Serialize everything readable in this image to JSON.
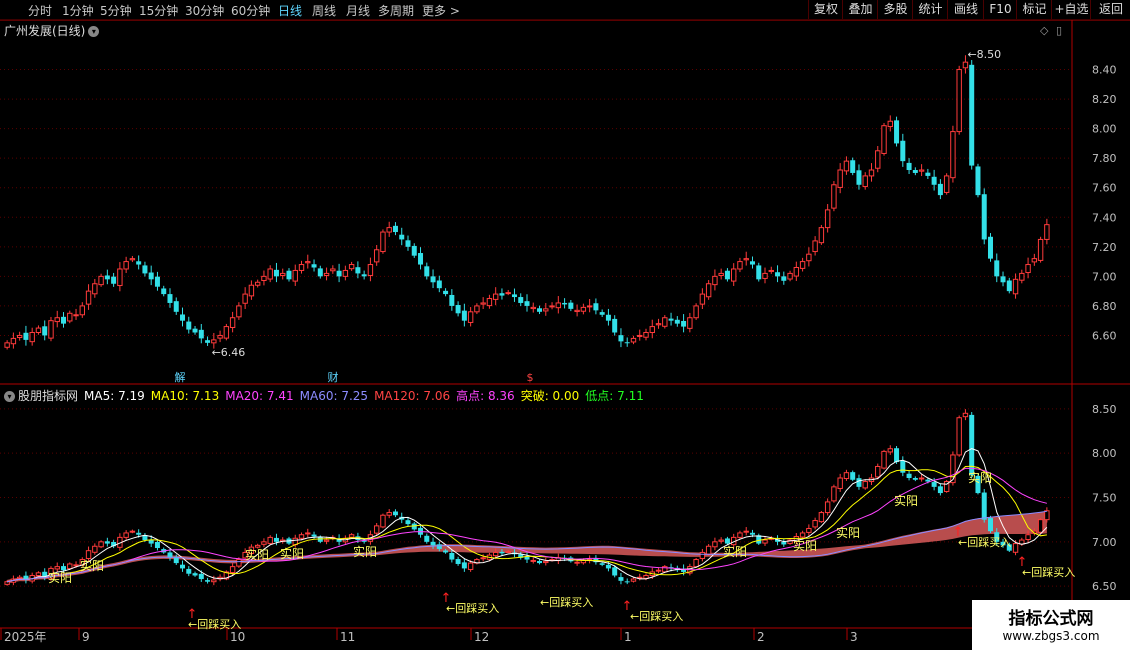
{
  "toolbar": {
    "timeframes": [
      "分时",
      "1分钟",
      "5分钟",
      "15分钟",
      "30分钟",
      "60分钟",
      "日线",
      "周线",
      "月线",
      "多周期",
      "更多"
    ],
    "active_timeframe": "日线",
    "right_buttons": [
      "复权",
      "叠加",
      "多股",
      "统计",
      "画线",
      "F10",
      "标记",
      "+自选",
      "返回"
    ]
  },
  "main_panel": {
    "title": "广州发展(日线)",
    "y_ticks": [
      "8.40",
      "8.20",
      "8.00",
      "7.80",
      "7.60",
      "7.40",
      "7.20",
      "7.00",
      "6.80",
      "6.60"
    ],
    "high_marker": "8.50",
    "low_marker": "6.46",
    "event_labels": [
      "解",
      "财",
      "$"
    ]
  },
  "indicator_panel": {
    "name": "股朋指标网",
    "values": [
      {
        "label": "MA5: 7.19",
        "color": "#ffffff"
      },
      {
        "label": "MA10: 7.13",
        "color": "#ffff00"
      },
      {
        "label": "MA20: 7.41",
        "color": "#ff44ff"
      },
      {
        "label": "MA60: 7.25",
        "color": "#8c8cff"
      },
      {
        "label": "MA120: 7.06",
        "color": "#ff4444"
      },
      {
        "label": "高点: 8.36",
        "color": "#ff44ff"
      },
      {
        "label": "突破: 0.00",
        "color": "#ffff00"
      },
      {
        "label": "低点: 7.11",
        "color": "#22ff22"
      }
    ],
    "y_ticks": [
      "8.50",
      "8.00",
      "7.50",
      "7.00",
      "6.50"
    ],
    "signal_labels": [
      "实阳",
      "实阳",
      "实阳",
      "实阳",
      "实阳",
      "实阳",
      "实阳",
      "实阳",
      "实阳",
      "实阳"
    ],
    "callback_labels": [
      "←回踩买入",
      "←回踩买入",
      "←回踩买入",
      "←回踩买入",
      "←回踩买入",
      "←回踩买入"
    ]
  },
  "x_axis": {
    "labels": [
      "2025年",
      "9",
      "10",
      "11",
      "12",
      "1",
      "2",
      "3"
    ]
  },
  "watermark": {
    "title": "指标公式网",
    "url": "www.zbgs3.com"
  },
  "chart_data": {
    "type": "candlestick",
    "security": "广州发展",
    "period": "日线",
    "ylim_main": [
      6.4,
      8.6
    ],
    "ylim_indicator": [
      6.4,
      8.6
    ],
    "x_ticks": [
      "2025年",
      "9",
      "10",
      "11",
      "12",
      "1",
      "2",
      "3"
    ],
    "closes": [
      6.55,
      6.58,
      6.6,
      6.57,
      6.62,
      6.65,
      6.6,
      6.7,
      6.72,
      6.68,
      6.75,
      6.74,
      6.8,
      6.9,
      6.95,
      7.0,
      6.98,
      6.95,
      7.05,
      7.1,
      7.12,
      7.08,
      7.02,
      6.98,
      6.93,
      6.88,
      6.82,
      6.76,
      6.7,
      6.64,
      6.62,
      6.58,
      6.55,
      6.57,
      6.6,
      6.66,
      6.72,
      6.8,
      6.88,
      6.94,
      6.96,
      7.0,
      7.05,
      7.0,
      7.02,
      6.98,
      7.04,
      7.08,
      7.1,
      7.06,
      7.0,
      7.02,
      7.05,
      7.0,
      7.04,
      7.08,
      7.02,
      7.0,
      7.08,
      7.18,
      7.3,
      7.33,
      7.3,
      7.25,
      7.2,
      7.14,
      7.08,
      7.0,
      6.96,
      6.92,
      6.88,
      6.8,
      6.75,
      6.7,
      6.76,
      6.8,
      6.82,
      6.85,
      6.88,
      6.87,
      6.89,
      6.86,
      6.82,
      6.8,
      6.79,
      6.76,
      6.78,
      6.8,
      6.82,
      6.81,
      6.78,
      6.77,
      6.79,
      6.8,
      6.77,
      6.74,
      6.7,
      6.62,
      6.56,
      6.55,
      6.58,
      6.6,
      6.62,
      6.66,
      6.68,
      6.72,
      6.7,
      6.68,
      6.66,
      6.72,
      6.8,
      6.88,
      6.95,
      7.0,
      7.02,
      6.98,
      7.05,
      7.1,
      7.12,
      7.08,
      6.98,
      7.02,
      7.04,
      7.0,
      6.97,
      7.02,
      7.06,
      7.1,
      7.15,
      7.24,
      7.33,
      7.45,
      7.62,
      7.72,
      7.78,
      7.7,
      7.62,
      7.68,
      7.72,
      7.85,
      8.02,
      8.05,
      7.9,
      7.78,
      7.72,
      7.7,
      7.72,
      7.68,
      7.62,
      7.55,
      7.68,
      7.98,
      8.4,
      8.45,
      7.75,
      7.55,
      7.25,
      7.12,
      7.0,
      6.96,
      6.9,
      6.98,
      7.02,
      7.08,
      7.12,
      7.25,
      7.35
    ]
  }
}
